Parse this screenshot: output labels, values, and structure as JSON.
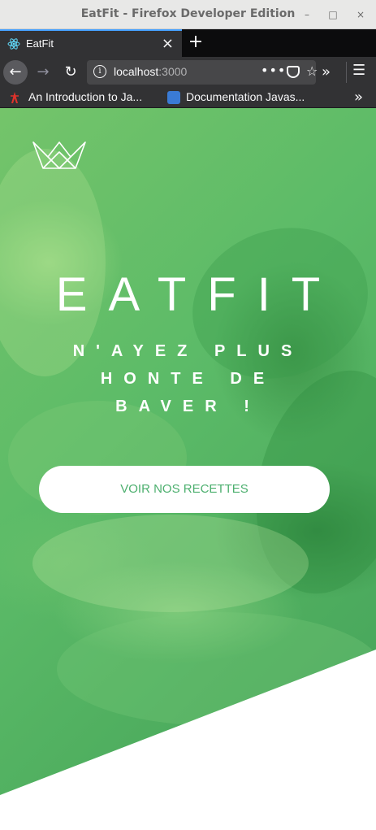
{
  "window": {
    "title": "EatFit - Firefox Developer Edition",
    "minimize_glyph": "–",
    "maximize_glyph": "□",
    "close_glyph": "×"
  },
  "tabs": [
    {
      "label": "EatFit",
      "icon": "react-icon",
      "close_glyph": "×"
    }
  ],
  "new_tab_glyph": "+",
  "nav": {
    "back_glyph": "←",
    "forward_glyph": "→",
    "reload_glyph": "↻",
    "url_host": "localhost",
    "url_port": ":3000",
    "info_glyph": "i",
    "page_actions_glyph": "•••",
    "star_glyph": "☆",
    "overflow_glyph": "»",
    "menu_glyph": "☰"
  },
  "bookmarks": [
    {
      "label": "An Introduction to Ja...",
      "icon": "bookmark-favicon-icon"
    },
    {
      "label": "Documentation Javas...",
      "icon": "bookmark-favicon-icon"
    }
  ],
  "bookmarks_more_glyph": "»",
  "page": {
    "brand": "EATFIT",
    "tagline": "N'AYEZ PLUS HONTE DE BAVER !",
    "cta_label": "VOIR NOS RECETTES",
    "logo_icon": "crown-logo-icon",
    "accent_color": "#5cbb68",
    "cta_text_color": "#4caf6e"
  }
}
